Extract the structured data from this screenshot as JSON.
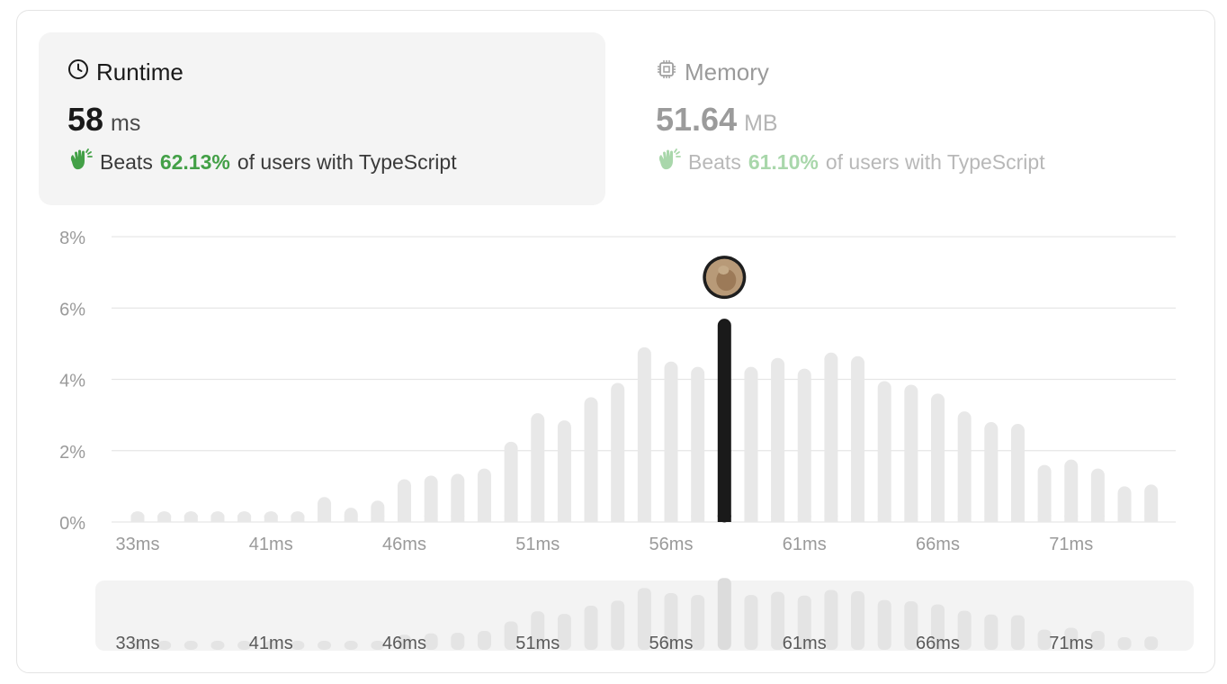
{
  "runtime": {
    "title": "Runtime",
    "value": "58",
    "unit": "ms",
    "beats_prefix": "Beats",
    "beats_pct": "62.13%",
    "beats_suffix": "of users with TypeScript"
  },
  "memory": {
    "title": "Memory",
    "value": "51.64",
    "unit": "MB",
    "beats_prefix": "Beats",
    "beats_pct": "61.10%",
    "beats_suffix": "of users with TypeScript"
  },
  "colors": {
    "bar": "#e8e8e8",
    "highlight_bar": "#1a1a1a",
    "beats_green": "#43a047",
    "grid": "#e6e6e6",
    "navigator_bg": "#f3f3f3"
  },
  "chart_data": {
    "type": "bar",
    "categories": [
      "33ms",
      "",
      "",
      "",
      "",
      "41ms",
      "",
      "",
      "",
      "",
      "46ms",
      "",
      "",
      "",
      "",
      "51ms",
      "",
      "",
      "",
      "",
      "56ms",
      "",
      "",
      "",
      "",
      "61ms",
      "",
      "",
      "",
      "",
      "66ms",
      "",
      "",
      "",
      "",
      "71ms",
      "",
      "",
      "",
      ""
    ],
    "values": [
      0.3,
      0.3,
      0.3,
      0.3,
      0.3,
      0.3,
      0.3,
      0.7,
      0.4,
      0.6,
      1.2,
      1.3,
      1.35,
      1.5,
      2.25,
      3.05,
      2.85,
      3.5,
      3.9,
      4.9,
      4.5,
      4.35,
      5.7,
      4.35,
      4.6,
      4.3,
      4.75,
      4.65,
      3.95,
      3.85,
      3.6,
      3.1,
      2.8,
      2.75,
      1.6,
      1.75,
      1.5,
      1.0,
      1.05
    ],
    "highlight_index": 22,
    "yticks": [
      "0%",
      "2%",
      "4%",
      "6%",
      "8%"
    ],
    "ylim": [
      0,
      8
    ],
    "grid": true,
    "navigator": true
  }
}
